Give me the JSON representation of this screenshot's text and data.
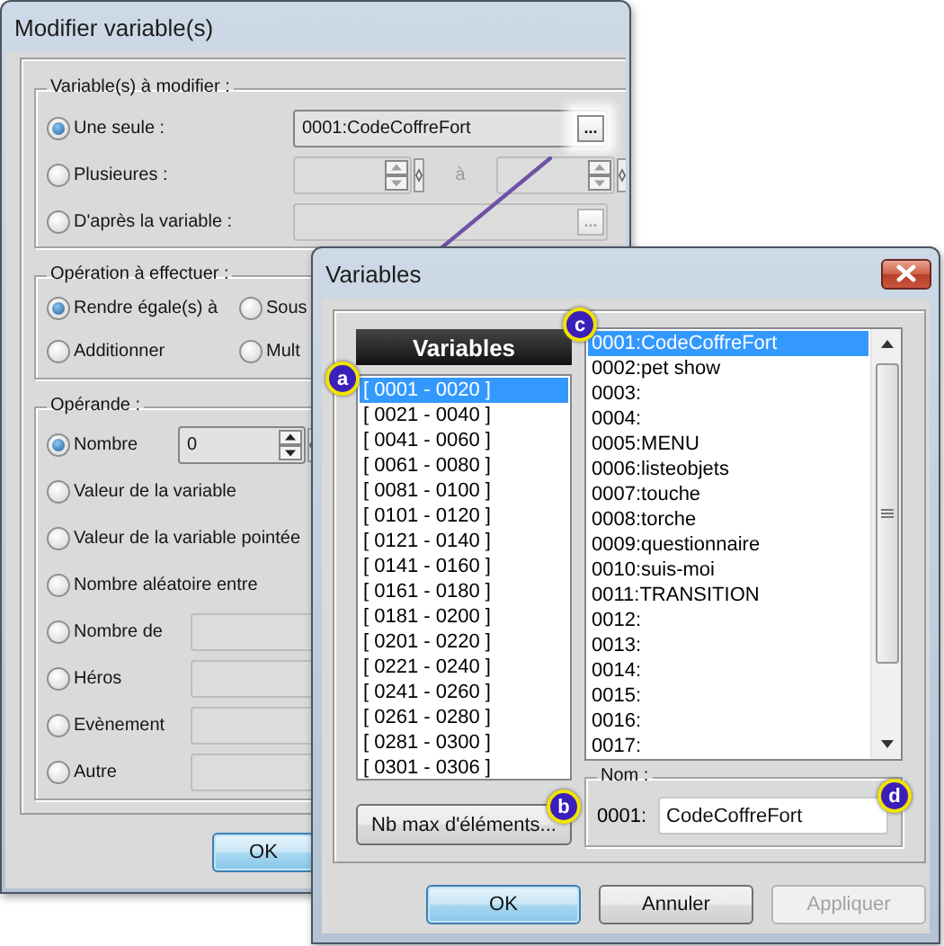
{
  "modify_dialog": {
    "title": "Modifier variable(s)",
    "target": {
      "legend": "Variable(s) à modifier :",
      "options": [
        {
          "kind": "browse",
          "label": "Une seule :",
          "selected": true,
          "value": "0001:CodeCoffreFort",
          "button": "...",
          "enabled": true,
          "highlighted": true
        },
        {
          "kind": "range",
          "label": "Plusieures :",
          "selected": false,
          "between": "à",
          "enabled": false
        },
        {
          "kind": "browse",
          "label": "D'après la variable :",
          "selected": false,
          "button": "...",
          "enabled": false,
          "highlighted": false
        }
      ]
    },
    "operation": {
      "legend": "Opération à effectuer :",
      "options": [
        {
          "label": "Rendre égale(s) à",
          "selected": true
        },
        {
          "label": "Sous",
          "selected": false
        },
        {
          "label": "Additionner",
          "selected": false
        },
        {
          "label": "Mult",
          "selected": false
        }
      ]
    },
    "operand": {
      "legend": "Opérande :",
      "options": [
        {
          "kind": "number",
          "label": "Nombre",
          "selected": true,
          "value": "0",
          "enabled": true
        },
        {
          "kind": "plain",
          "label": "Valeur de la variable",
          "selected": false
        },
        {
          "kind": "plain",
          "label": "Valeur de la variable pointée",
          "selected": false
        },
        {
          "kind": "plain",
          "label": "Nombre aléatoire entre",
          "selected": false
        },
        {
          "kind": "field",
          "label": "Nombre de",
          "selected": false,
          "enabled": false
        },
        {
          "kind": "field",
          "label": "Héros",
          "selected": false,
          "enabled": false
        },
        {
          "kind": "field",
          "label": "Evènement",
          "selected": false,
          "enabled": false
        },
        {
          "kind": "field",
          "label": "Autre",
          "selected": false,
          "enabled": false
        }
      ]
    },
    "buttons": [
      {
        "label": "OK",
        "default": true,
        "disabled": false
      }
    ]
  },
  "variables_dialog": {
    "title": "Variables",
    "header": "Variables",
    "ranges": [
      {
        "label": "[ 0001 - 0020 ]",
        "selected": true
      },
      {
        "label": "[ 0021 - 0040 ]",
        "selected": false
      },
      {
        "label": "[ 0041 - 0060 ]",
        "selected": false
      },
      {
        "label": "[ 0061 - 0080 ]",
        "selected": false
      },
      {
        "label": "[ 0081 - 0100 ]",
        "selected": false
      },
      {
        "label": "[ 0101 - 0120 ]",
        "selected": false
      },
      {
        "label": "[ 0121 - 0140 ]",
        "selected": false
      },
      {
        "label": "[ 0141 - 0160 ]",
        "selected": false
      },
      {
        "label": "[ 0161 - 0180 ]",
        "selected": false
      },
      {
        "label": "[ 0181 - 0200 ]",
        "selected": false
      },
      {
        "label": "[ 0201 - 0220 ]",
        "selected": false
      },
      {
        "label": "[ 0221 - 0240 ]",
        "selected": false
      },
      {
        "label": "[ 0241 - 0260 ]",
        "selected": false
      },
      {
        "label": "[ 0261 - 0280 ]",
        "selected": false
      },
      {
        "label": "[ 0281 - 0300 ]",
        "selected": false
      },
      {
        "label": "[ 0301 - 0306 ]",
        "selected": false
      }
    ],
    "variables": [
      {
        "label": "0001:CodeCoffreFort",
        "selected": true
      },
      {
        "label": "0002:pet show",
        "selected": false
      },
      {
        "label": "0003:",
        "selected": false
      },
      {
        "label": "0004:",
        "selected": false
      },
      {
        "label": "0005:MENU",
        "selected": false
      },
      {
        "label": "0006:listeobjets",
        "selected": false
      },
      {
        "label": "0007:touche",
        "selected": false
      },
      {
        "label": "0008:torche",
        "selected": false
      },
      {
        "label": "0009:questionnaire",
        "selected": false
      },
      {
        "label": "0010:suis-moi",
        "selected": false
      },
      {
        "label": "0011:TRANSITION",
        "selected": false
      },
      {
        "label": "0012:",
        "selected": false
      },
      {
        "label": "0013:",
        "selected": false
      },
      {
        "label": "0014:",
        "selected": false
      },
      {
        "label": "0015:",
        "selected": false
      },
      {
        "label": "0016:",
        "selected": false
      },
      {
        "label": "0017:",
        "selected": false
      }
    ],
    "max_button": "Nb max d'éléments...",
    "name_group": {
      "legend": "Nom :",
      "number": "0001:",
      "value": "CodeCoffreFort"
    },
    "buttons": [
      {
        "label": "OK",
        "default": true,
        "disabled": false
      },
      {
        "label": "Annuler",
        "default": false,
        "disabled": false
      },
      {
        "label": "Appliquer",
        "default": false,
        "disabled": true
      }
    ]
  },
  "annotations": [
    {
      "label": "c"
    },
    {
      "label": "a"
    },
    {
      "label": "b"
    },
    {
      "label": "d"
    }
  ]
}
